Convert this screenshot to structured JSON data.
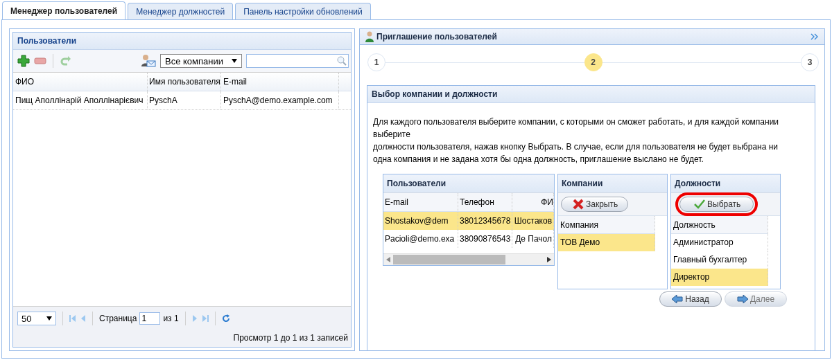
{
  "tabs": [
    {
      "label": "Менеджер пользователей",
      "selected": true
    },
    {
      "label": "Менеджер должностей",
      "selected": false
    },
    {
      "label": "Панель настройки обновлений",
      "selected": false
    }
  ],
  "users_panel": {
    "title": "Пользователи",
    "company_filter": "Все компании",
    "columns": [
      "ФИО",
      "Имя пользователя",
      "E-mail"
    ],
    "rows": [
      {
        "cells": [
          "Пищ Аполлінарій Аполлінарієвич",
          "PyschA",
          "PyschA@demo.example.com"
        ],
        "selected": false
      }
    ],
    "pager": {
      "page_size": "50",
      "page_label": "Страница",
      "page": "1",
      "of": "из 1",
      "summary": "Просмотр 1 до 1 из 1 записей"
    }
  },
  "invite_panel": {
    "title": "Приглашение пользователей",
    "steps": [
      {
        "label": "1",
        "selected": false
      },
      {
        "label": "2",
        "selected": true
      },
      {
        "label": "3",
        "selected": false
      }
    ],
    "section_title": "Выбор компании и должности",
    "instructions": [
      "Для каждого пользователя выберите компании, с которыми он сможет работать, и для каждой компании выберите",
      "должности пользователя, нажав кнопку Выбрать. В случае, если для пользователя не будет выбрана ни одна компания и не задана хотя бы одна должность, приглашение выслано не будет."
    ],
    "users_grid": {
      "title": "Пользователи",
      "columns": [
        "E-mail",
        "Телефон",
        "ФИ"
      ],
      "rows": [
        {
          "cells": [
            "Shostakov@dem",
            "38012345678",
            "Шостаков"
          ],
          "selected": true
        },
        {
          "cells": [
            "Pacioli@demo.exa",
            "38090876543",
            "Де Пачол"
          ],
          "selected": false
        }
      ]
    },
    "companies_grid": {
      "title": "Компании",
      "button": "Закрыть",
      "column": "Компания",
      "rows": [
        {
          "label": "ТОВ Демо",
          "selected": true
        }
      ]
    },
    "positions_grid": {
      "title": "Должности",
      "button": {
        "label": "Выбрать",
        "highlighted": true
      },
      "column": "Должность",
      "rows": [
        {
          "label": "Администратор",
          "selected": false
        },
        {
          "label": "Главный бухгалтер",
          "selected": false
        },
        {
          "label": "Директор",
          "selected": true
        }
      ]
    },
    "back_button": {
      "label": "Назад",
      "disabled": false
    },
    "next_button": {
      "label": "Далее",
      "disabled": true
    }
  }
}
